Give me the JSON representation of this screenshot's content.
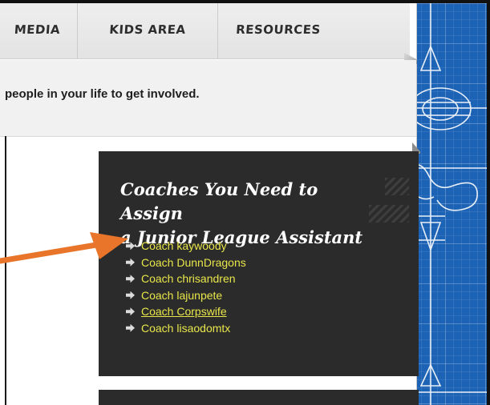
{
  "nav": {
    "items": [
      "MEDIA",
      "KIDS AREA",
      "RESOURCES"
    ]
  },
  "intro": {
    "text": "people in your life to get involved."
  },
  "panel": {
    "title_line1": "Coaches You Need to Assign",
    "title_line2": "a Junior League Assistant",
    "coaches": [
      "Coach kaywoody",
      "Coach DunnDragons",
      "Coach chrisandren",
      "Coach lajunpete",
      "Coach Corpswife",
      "Coach lisaodomtx"
    ],
    "hovered_index": 4
  },
  "colors": {
    "link": "#e8e64a",
    "panel_bg": "#2b2b2b",
    "annotation_arrow": "#e8752a",
    "blueprint": "#1d63b5"
  }
}
